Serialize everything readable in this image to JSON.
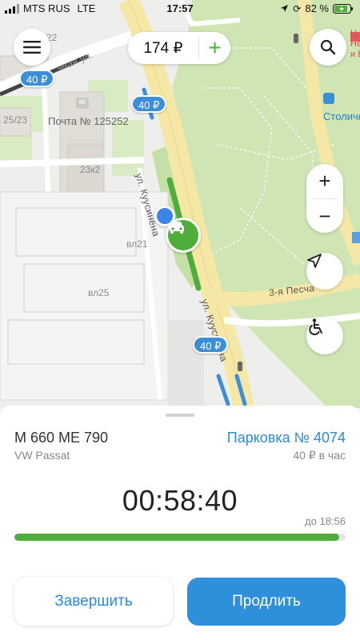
{
  "status_bar": {
    "carrier": "MTS RUS",
    "network": "LTE",
    "time": "17:57",
    "battery": "82 %"
  },
  "header": {
    "menu_icon": "hamburger-icon",
    "balance": "174 ₽",
    "add_balance_label": "+",
    "search_icon": "search-icon"
  },
  "map": {
    "streets": [
      "ул. Куусинена",
      "ул. Куусинена",
      "3-я Песча",
      "…чная ул."
    ],
    "post_office": "Почта № 125252",
    "buildings": [
      "25/23",
      "23к2",
      "вл21",
      "вл25",
      "22"
    ],
    "metro_station": "Столичн",
    "poi_text": "Ц\nНе\nи Б",
    "price_pins": [
      "40 ₽",
      "40 ₽",
      "40 ₽"
    ],
    "zoom_in": "+",
    "zoom_out": "−",
    "colors": {
      "park": "#cfe5b4",
      "road": "#f5e7a6",
      "parking_active": "#4ead3b",
      "parking_zone": "#3b8fd6"
    }
  },
  "session": {
    "plate": "М 660 МЕ 790",
    "car_model": "VW Passat",
    "parking_zone": "Парковка № 4074",
    "rate": "40 ₽ в час",
    "timer": "00:58:40",
    "until": "до 18:56",
    "progress_fraction": 0.98
  },
  "actions": {
    "finish": "Завершить",
    "extend": "Продлить"
  },
  "colors": {
    "accent_blue": "#2e8fdb",
    "accent_green": "#4ead3b"
  }
}
